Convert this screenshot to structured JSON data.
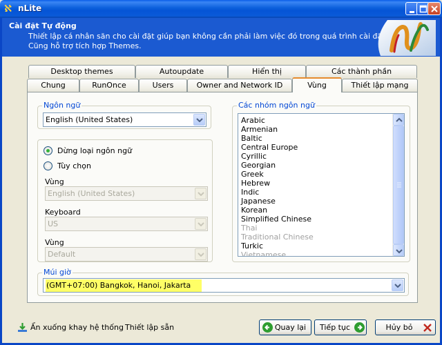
{
  "window": {
    "title": "nLite"
  },
  "header": {
    "title": "Cài đặt Tự động",
    "desc1": "Thiết lập cá nhân săn cho cài đặt giúp bạn không cần phải làm việc đó trong quá trình cài đặt.",
    "desc2": "Cũng hỗ trợ tích hợp Themes."
  },
  "tabs": {
    "row1": [
      "Desktop themes",
      "Autoupdate",
      "Hiển thị",
      "Các thành phần"
    ],
    "row2": [
      "Chung",
      "RunOnce",
      "Users",
      "Owner and Network ID",
      "Vùng",
      "Thiết lập mạng"
    ],
    "active": "Vùng"
  },
  "language": {
    "label": "Ngôn ngữ",
    "value": "English (United States)"
  },
  "options": {
    "radio_same": "Dừng loại ngôn ngữ",
    "radio_custom": "Tùy chọn",
    "region_label": "Vùng",
    "region_value": "English (United States)",
    "keyboard_label": "Keyboard",
    "keyboard_value": "US",
    "region2_label": "Vùng",
    "region2_value": "Default"
  },
  "language_groups": {
    "label": "Các nhóm ngôn ngữ",
    "items": [
      "Arabic",
      "Armenian",
      "Baltic",
      "Central Europe",
      "Cyrillic",
      "Georgian",
      "Greek",
      "Hebrew",
      "Indic",
      "Japanese",
      "Korean",
      "Simplified Chinese",
      "Thai",
      "Traditional Chinese",
      "Turkic",
      "Vietnamese"
    ],
    "dimmed": [
      "Thai",
      "Traditional Chinese",
      "Vietnamese"
    ]
  },
  "timezone": {
    "label": "Múi giờ",
    "value": "(GMT+07:00) Bangkok, Hanoi, Jakarta"
  },
  "footer": {
    "tray_label": "Ẩn xuống khay hệ thống",
    "preset_label": "Thiết lập sẵn",
    "back_label": "Quay lại",
    "next_label": "Tiếp tục",
    "cancel_label": "Hủy bỏ"
  },
  "colors": {
    "title_bar": "#0b5fdb",
    "header": "#1b5ad1",
    "highlight": "#ffff66",
    "group_label": "#0046d5",
    "active_tab_accent": "#e68b2c"
  }
}
